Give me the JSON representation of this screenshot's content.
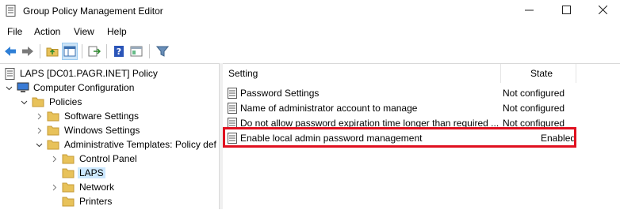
{
  "window": {
    "title": "Group Policy Management Editor",
    "minimize": "—",
    "maximize": "☐",
    "close": "✕"
  },
  "menu": [
    "File",
    "Action",
    "View",
    "Help"
  ],
  "tree": [
    {
      "label": "LAPS [DC01.PAGR.INET] Policy"
    },
    {
      "label": "Computer Configuration"
    },
    {
      "label": "Policies"
    },
    {
      "label": "Software Settings"
    },
    {
      "label": "Windows Settings"
    },
    {
      "label": "Administrative Templates: Policy def"
    },
    {
      "label": "Control Panel"
    },
    {
      "label": "LAPS"
    },
    {
      "label": "Network"
    },
    {
      "label": "Printers"
    }
  ],
  "list": {
    "columns": {
      "setting": "Setting",
      "state": "State"
    },
    "rows": [
      {
        "name": "Password Settings",
        "state": "Not configured"
      },
      {
        "name": "Name of administrator account to manage",
        "state": "Not configured"
      },
      {
        "name": "Do not allow password expiration time longer than required ...",
        "state": "Not configured"
      },
      {
        "name": "Enable local admin password management",
        "state": "Enabled"
      }
    ]
  },
  "colors": {
    "highlight_border": "#e0101f",
    "selection": "#cce8ff",
    "folder": "#e8c25a"
  }
}
